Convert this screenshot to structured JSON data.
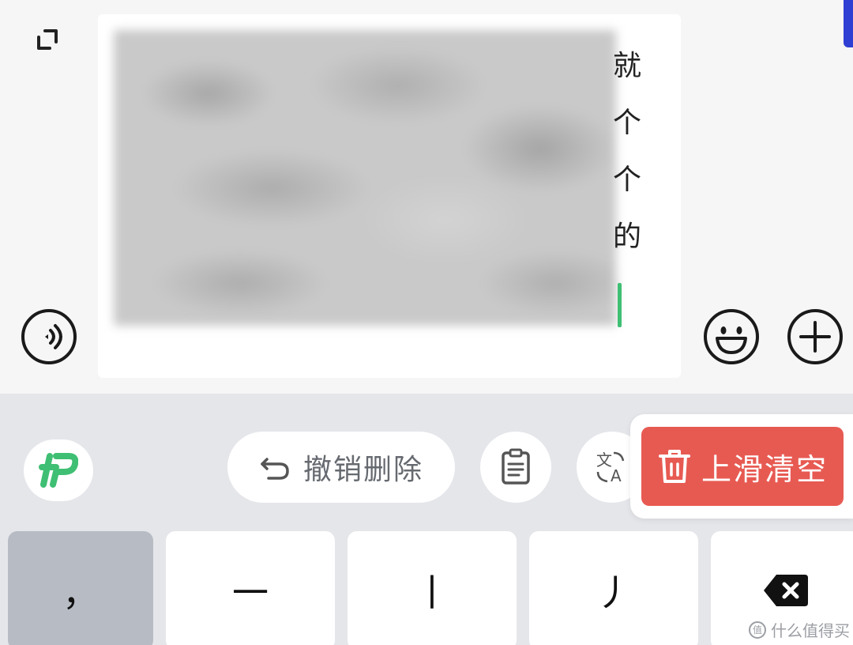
{
  "compose": {
    "edge_glyphs": [
      "就",
      "个",
      "个",
      "的"
    ]
  },
  "toolbar": {
    "undo_delete_label": "撤销删除",
    "clear_label": "上滑清空"
  },
  "keys": {
    "comma": "，",
    "heng": "一",
    "shu": "丨",
    "pie": "丿"
  },
  "watermark": {
    "text": "什么值得买",
    "badge": "值"
  },
  "colors": {
    "accent_green": "#3fbf73",
    "clear_red": "#e75a52",
    "scroll_blue": "#2f3fd3"
  },
  "icons": {
    "expand": "expand-icon",
    "voice": "voice-icon",
    "emoji": "emoji-icon",
    "plus": "plus-icon",
    "logo": "input-method-logo-icon",
    "undo": "undo-icon",
    "clipboard": "clipboard-icon",
    "translate": "translate-icon",
    "trash": "trash-icon",
    "delete": "backspace-icon"
  }
}
